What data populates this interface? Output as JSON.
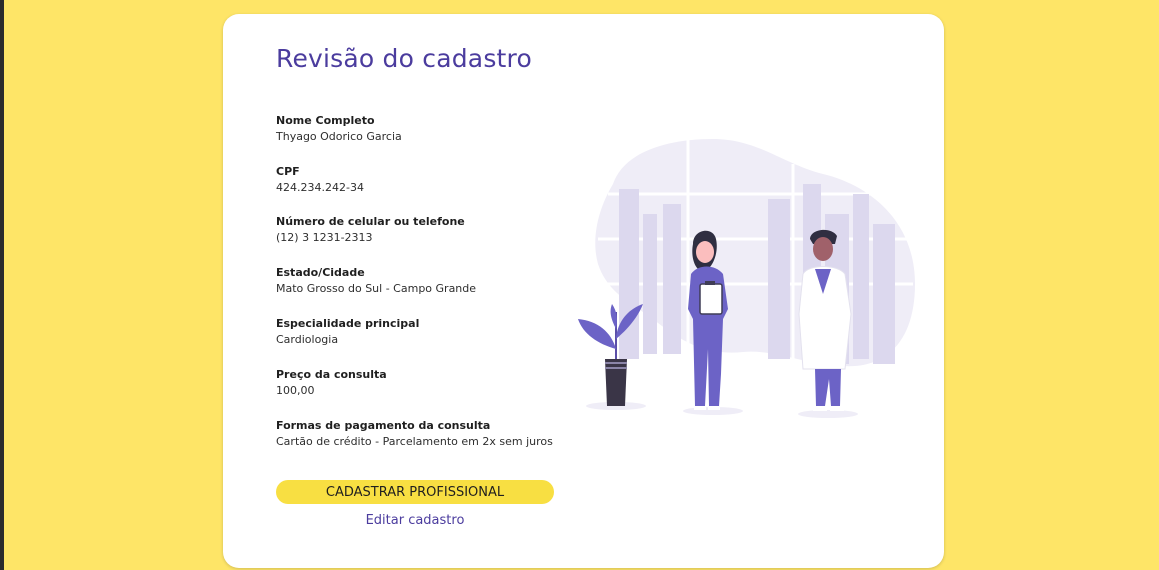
{
  "page": {
    "title": "Revisão do cadastro"
  },
  "fields": [
    {
      "label": "Nome Completo",
      "value": "Thyago Odorico Garcia"
    },
    {
      "label": "CPF",
      "value": "424.234.242-34"
    },
    {
      "label": "Número de celular ou telefone",
      "value": "(12) 3 1231-2313"
    },
    {
      "label": "Estado/Cidade",
      "value": "Mato Grosso do Sul - Campo Grande"
    },
    {
      "label": "Especialidade principal",
      "value": "Cardiologia"
    },
    {
      "label": "Preço da consulta",
      "value": "100,00"
    },
    {
      "label": "Formas de pagamento da consulta",
      "value": "Cartão de crédito - Parcelamento em 2x sem juros"
    }
  ],
  "actions": {
    "submit_label": "CADASTRAR PROFISSIONAL",
    "edit_label": "Editar cadastro"
  },
  "colors": {
    "background": "#fee567",
    "accent": "#4b3c9e",
    "button": "#f8df42",
    "illustration_purple": "#6c63c6"
  },
  "illustration": {
    "icon": "doctors-illustration"
  }
}
